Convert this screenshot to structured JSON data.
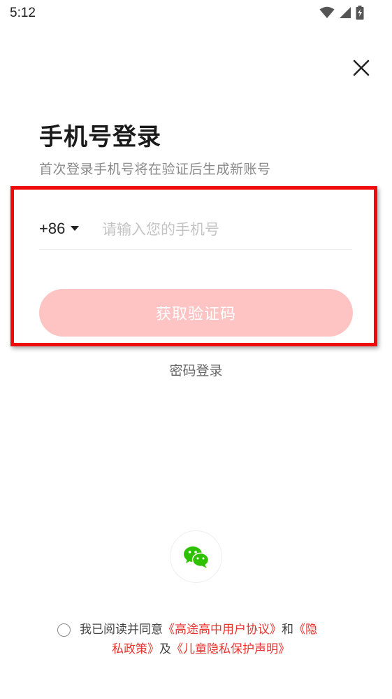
{
  "status_bar": {
    "time": "5:12",
    "icons": [
      "wifi-icon",
      "cellular-signal-icon",
      "battery-charging-icon"
    ]
  },
  "header": {
    "close_icon": "close-icon"
  },
  "login": {
    "title": "手机号登录",
    "subtitle": "首次登录手机号将在验证后生成新账号",
    "country_code": "+86",
    "phone_placeholder": "请输入您的手机号",
    "phone_value": "",
    "get_code_label": "获取验证码",
    "password_login_label": "密码登录"
  },
  "social": {
    "wechat_icon": "wechat-icon"
  },
  "agreement": {
    "prefix": "我已阅读并同意",
    "user_agreement": "《高途高中用户协议》",
    "and": "和",
    "privacy_part1": "《隐",
    "privacy_part2": "私政策》",
    "ji": "及",
    "children_privacy": "《儿童隐私保护声明》"
  },
  "colors": {
    "accent_red": "#e8342f",
    "button_disabled": "#fec4c3",
    "highlight_border": "#ef0b0b",
    "wechat_green": "#2dc100"
  }
}
